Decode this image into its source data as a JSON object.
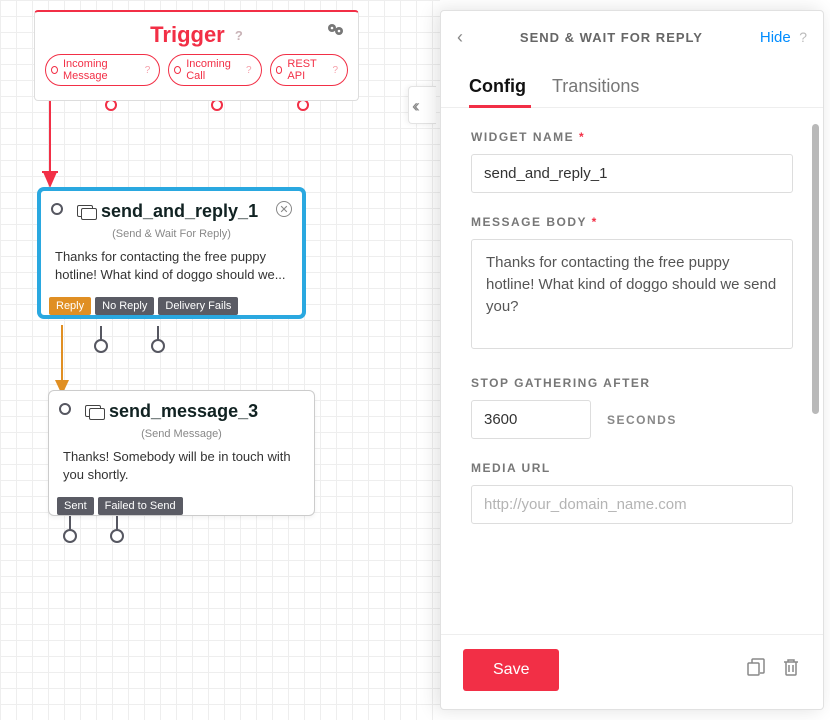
{
  "trigger": {
    "title": "Trigger",
    "pills": [
      "Incoming Message",
      "Incoming Call",
      "REST API"
    ]
  },
  "node1": {
    "name": "send_and_reply_1",
    "subtitle": "(Send & Wait For Reply)",
    "body": "Thanks for contacting the free puppy hotline! What kind of doggo should we...",
    "outs": [
      "Reply",
      "No Reply",
      "Delivery Fails"
    ]
  },
  "node2": {
    "name": "send_message_3",
    "subtitle": "(Send Message)",
    "body": "Thanks! Somebody will be in touch with you shortly.",
    "outs": [
      "Sent",
      "Failed to Send"
    ]
  },
  "panel": {
    "title": "SEND & WAIT FOR REPLY",
    "hide": "Hide",
    "tabs": [
      "Config",
      "Transitions"
    ],
    "fields": {
      "widget_name_label": "WIDGET NAME",
      "widget_name_value": "send_and_reply_1",
      "message_body_label": "MESSAGE BODY",
      "message_body_value": "Thanks for contacting the free puppy hotline! What kind of doggo should we send you?",
      "stop_label": "STOP GATHERING AFTER",
      "stop_value": "3600",
      "stop_unit": "SECONDS",
      "media_label": "MEDIA URL",
      "media_placeholder": "http://your_domain_name.com"
    },
    "save": "Save"
  }
}
